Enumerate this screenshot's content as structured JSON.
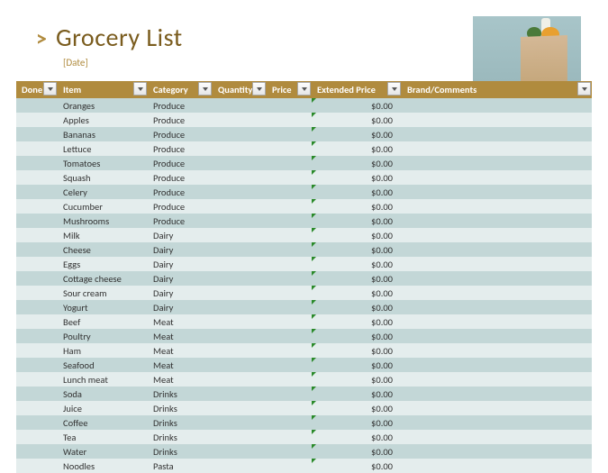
{
  "header": {
    "chevron": ">",
    "title": "Grocery List",
    "date": "[Date]"
  },
  "columns": {
    "done": "Done?",
    "item": "Item",
    "category": "Category",
    "quantity": "Quantity",
    "price": "Price",
    "extended": "Extended Price",
    "brand": "Brand/Comments"
  },
  "rows": [
    {
      "item": "Oranges",
      "category": "Produce",
      "ext": "$0.00"
    },
    {
      "item": "Apples",
      "category": "Produce",
      "ext": "$0.00"
    },
    {
      "item": "Bananas",
      "category": "Produce",
      "ext": "$0.00"
    },
    {
      "item": "Lettuce",
      "category": "Produce",
      "ext": "$0.00"
    },
    {
      "item": "Tomatoes",
      "category": "Produce",
      "ext": "$0.00"
    },
    {
      "item": "Squash",
      "category": "Produce",
      "ext": "$0.00"
    },
    {
      "item": "Celery",
      "category": "Produce",
      "ext": "$0.00"
    },
    {
      "item": "Cucumber",
      "category": "Produce",
      "ext": "$0.00"
    },
    {
      "item": "Mushrooms",
      "category": "Produce",
      "ext": "$0.00"
    },
    {
      "item": "Milk",
      "category": "Dairy",
      "ext": "$0.00"
    },
    {
      "item": "Cheese",
      "category": "Dairy",
      "ext": "$0.00"
    },
    {
      "item": "Eggs",
      "category": "Dairy",
      "ext": "$0.00"
    },
    {
      "item": "Cottage cheese",
      "category": "Dairy",
      "ext": "$0.00"
    },
    {
      "item": "Sour cream",
      "category": "Dairy",
      "ext": "$0.00"
    },
    {
      "item": "Yogurt",
      "category": "Dairy",
      "ext": "$0.00"
    },
    {
      "item": "Beef",
      "category": "Meat",
      "ext": "$0.00"
    },
    {
      "item": "Poultry",
      "category": "Meat",
      "ext": "$0.00"
    },
    {
      "item": "Ham",
      "category": "Meat",
      "ext": "$0.00"
    },
    {
      "item": "Seafood",
      "category": "Meat",
      "ext": "$0.00"
    },
    {
      "item": "Lunch meat",
      "category": "Meat",
      "ext": "$0.00"
    },
    {
      "item": "Soda",
      "category": "Drinks",
      "ext": "$0.00"
    },
    {
      "item": "Juice",
      "category": "Drinks",
      "ext": "$0.00"
    },
    {
      "item": "Coffee",
      "category": "Drinks",
      "ext": "$0.00"
    },
    {
      "item": "Tea",
      "category": "Drinks",
      "ext": "$0.00"
    },
    {
      "item": "Water",
      "category": "Drinks",
      "ext": "$0.00"
    },
    {
      "item": "Noodles",
      "category": "Pasta",
      "ext": "$0.00"
    }
  ]
}
